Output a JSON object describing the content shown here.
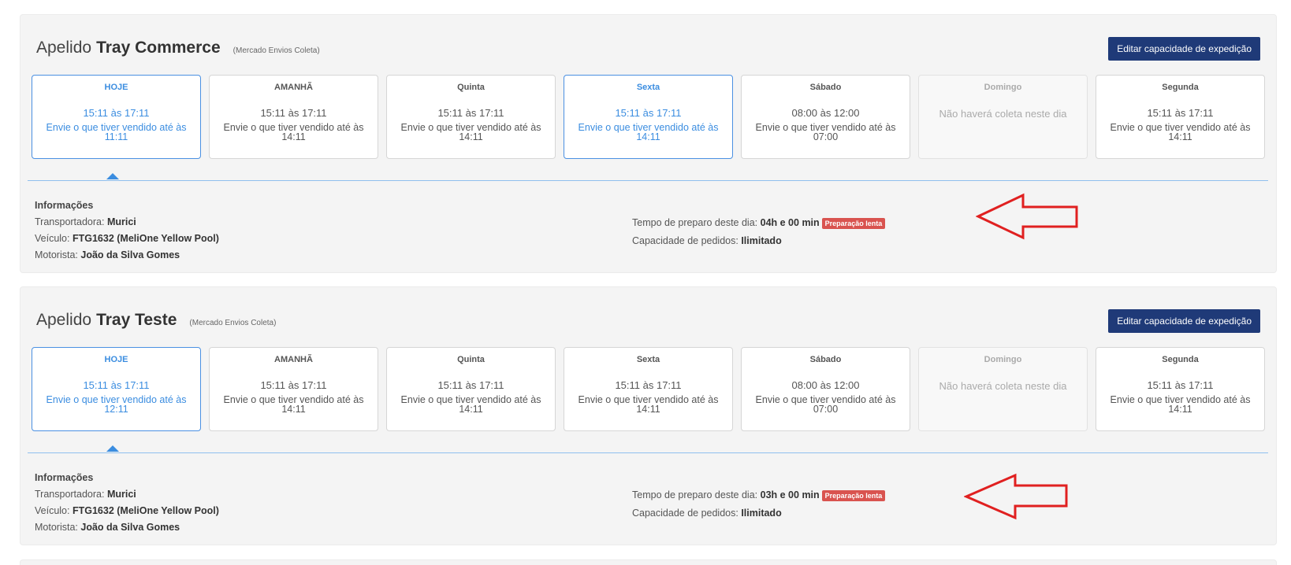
{
  "shipments": [
    {
      "nick_prefix": "Apelido",
      "nick_name": "Tray Commerce",
      "nick_sub": "(Mercado Envios Coleta)",
      "edit_label": "Editar capacidade de expedição",
      "days": [
        {
          "name": "HOJE",
          "time": "15:11 às 17:11",
          "note": "Envie o que tiver vendido até às 11:11",
          "state": "active"
        },
        {
          "name": "AMANHÃ",
          "time": "15:11 às 17:11",
          "note": "Envie o que tiver vendido até às 14:11",
          "state": "normal"
        },
        {
          "name": "Quinta",
          "time": "15:11 às 17:11",
          "note": "Envie o que tiver vendido até às 14:11",
          "state": "normal"
        },
        {
          "name": "Sexta",
          "time": "15:11 às 17:11",
          "note": "Envie o que tiver vendido até às 14:11",
          "state": "active"
        },
        {
          "name": "Sábado",
          "time": "08:00 às 12:00",
          "note": "Envie o que tiver vendido até às 07:00",
          "state": "normal"
        },
        {
          "name": "Domingo",
          "time": "",
          "note": "Não haverá coleta neste dia",
          "state": "closed"
        },
        {
          "name": "Segunda",
          "time": "15:11 às 17:11",
          "note": "Envie o que tiver vendido até às 14:11",
          "state": "normal"
        }
      ],
      "info": {
        "title": "Informações",
        "carrier_label": "Transportadora:",
        "carrier": "Murici",
        "vehicle_label": "Veículo:",
        "vehicle": "FTG1632 (MeliOne Yellow Pool)",
        "driver_label": "Motorista:",
        "driver": "João da Silva Gomes",
        "prep_label": "Tempo de preparo deste dia:",
        "prep": "04h e 00 min",
        "badge": "Preparação lenta",
        "capacity_label": "Capacidade de pedidos:",
        "capacity": "Ilimitado"
      }
    },
    {
      "nick_prefix": "Apelido",
      "nick_name": "Tray Teste",
      "nick_sub": "(Mercado Envios Coleta)",
      "edit_label": "Editar capacidade de expedição",
      "days": [
        {
          "name": "HOJE",
          "time": "15:11 às 17:11",
          "note": "Envie o que tiver vendido até às 12:11",
          "state": "active"
        },
        {
          "name": "AMANHÃ",
          "time": "15:11 às 17:11",
          "note": "Envie o que tiver vendido até às 14:11",
          "state": "normal"
        },
        {
          "name": "Quinta",
          "time": "15:11 às 17:11",
          "note": "Envie o que tiver vendido até às 14:11",
          "state": "normal"
        },
        {
          "name": "Sexta",
          "time": "15:11 às 17:11",
          "note": "Envie o que tiver vendido até às 14:11",
          "state": "normal"
        },
        {
          "name": "Sábado",
          "time": "08:00 às 12:00",
          "note": "Envie o que tiver vendido até às 07:00",
          "state": "normal"
        },
        {
          "name": "Domingo",
          "time": "",
          "note": "Não haverá coleta neste dia",
          "state": "closed"
        },
        {
          "name": "Segunda",
          "time": "15:11 às 17:11",
          "note": "Envie o que tiver vendido até às 14:11",
          "state": "normal"
        }
      ],
      "info": {
        "title": "Informações",
        "carrier_label": "Transportadora:",
        "carrier": "Murici",
        "vehicle_label": "Veículo:",
        "vehicle": "FTG1632 (MeliOne Yellow Pool)",
        "driver_label": "Motorista:",
        "driver": "João da Silva Gomes",
        "prep_label": "Tempo de preparo deste dia:",
        "prep": "03h e 00 min",
        "badge": "Preparação lenta",
        "capacity_label": "Capacidade de pedidos:",
        "capacity": "Ilimitado"
      }
    }
  ],
  "colors": {
    "accent": "#3b8de0",
    "button": "#1f3a78",
    "badge": "#d9534f",
    "annotation_arrow": "#e02020"
  },
  "annotation_icon": "red-arrow-left-icon"
}
